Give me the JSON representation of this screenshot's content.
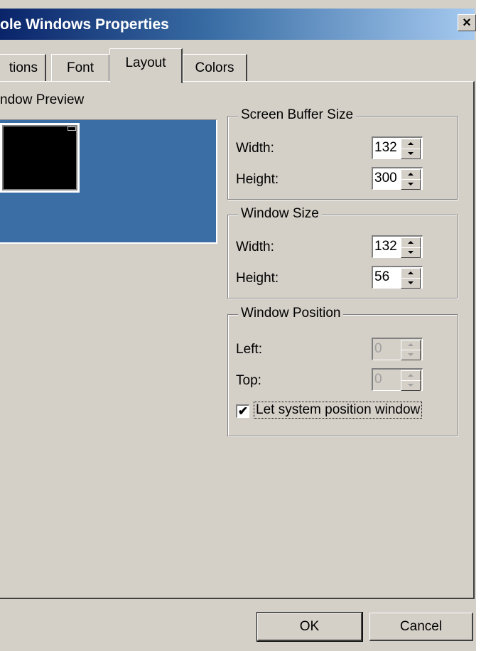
{
  "window": {
    "title": "ole Windows Properties",
    "close_glyph": "×"
  },
  "tabs": [
    {
      "label": "tions"
    },
    {
      "label": "Font"
    },
    {
      "label": "Layout",
      "selected": true
    },
    {
      "label": "Colors"
    }
  ],
  "preview": {
    "label": "ndow Preview",
    "background_color": "#3a6ea5"
  },
  "screen_buffer": {
    "title": "Screen Buffer Size",
    "width_label": "Width:",
    "width_value": "132",
    "height_label": "Height:",
    "height_value": "300"
  },
  "window_size": {
    "title": "Window Size",
    "width_label": "Width:",
    "width_value": "132",
    "height_label": "Height:",
    "height_value": "56"
  },
  "window_position": {
    "title": "Window Position",
    "left_label": "Left:",
    "left_value": "0",
    "top_label": "Top:",
    "top_value": "0",
    "checkbox_label": "Let system position window",
    "checkbox_checked": true,
    "check_glyph": "✔"
  },
  "buttons": {
    "ok": "OK",
    "cancel": "Cancel"
  }
}
